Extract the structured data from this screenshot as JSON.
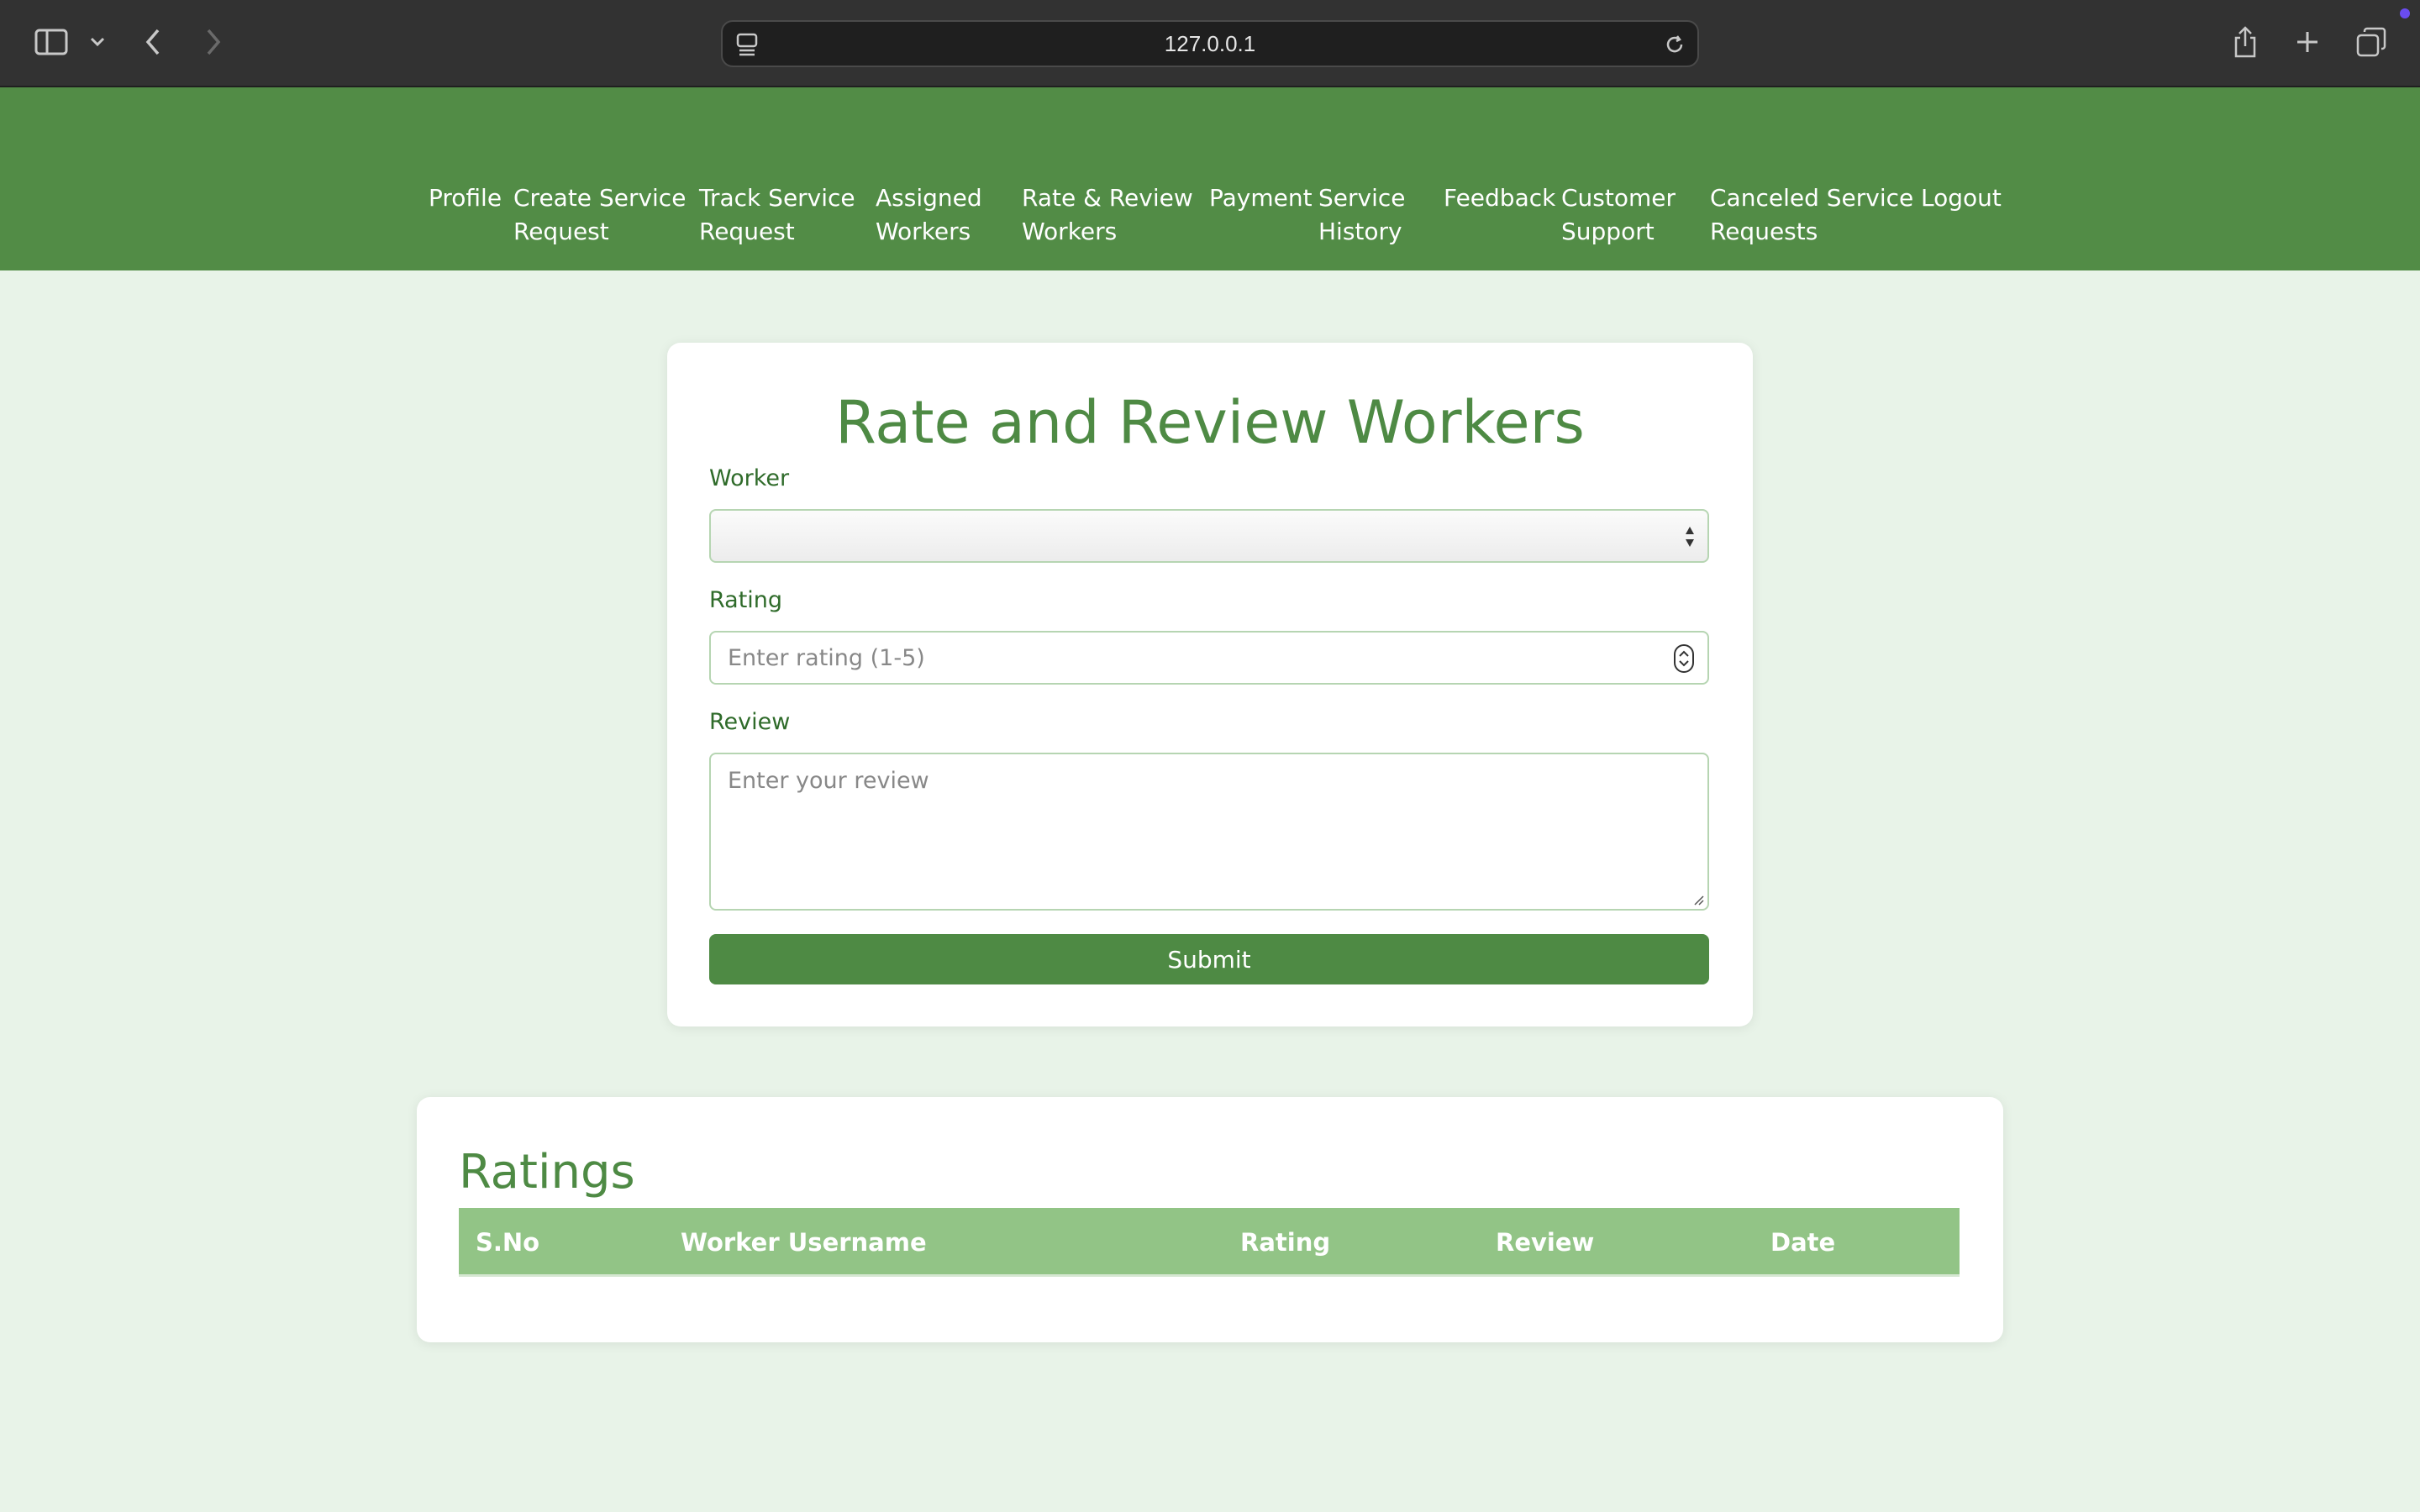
{
  "browser": {
    "url": "127.0.0.1"
  },
  "nav": {
    "items": [
      {
        "label_line1": "Profile",
        "label_line2": ""
      },
      {
        "label_line1": "Create Service",
        "label_line2": "Request"
      },
      {
        "label_line1": "Track Service",
        "label_line2": "Request"
      },
      {
        "label_line1": "Assigned",
        "label_line2": "Workers"
      },
      {
        "label_line1": "Rate & Review",
        "label_line2": "Workers"
      },
      {
        "label_line1": "Payment",
        "label_line2": ""
      },
      {
        "label_line1": "Service",
        "label_line2": "History"
      },
      {
        "label_line1": "Feedback",
        "label_line2": ""
      },
      {
        "label_line1": "Customer",
        "label_line2": "Support"
      },
      {
        "label_line1": "Canceled Service",
        "label_line2": "Requests"
      },
      {
        "label_line1": "Logout",
        "label_line2": ""
      }
    ]
  },
  "form": {
    "title": "Rate and Review Workers",
    "worker_label": "Worker",
    "worker_value": "",
    "rating_label": "Rating",
    "rating_placeholder": "Enter rating (1-5)",
    "review_label": "Review",
    "review_placeholder": "Enter your review",
    "submit_label": "Submit"
  },
  "ratings": {
    "title": "Ratings",
    "columns": [
      "S.No",
      "Worker Username",
      "Rating",
      "Review",
      "Date"
    ],
    "rows": []
  },
  "colors": {
    "nav_green": "#528c46",
    "accent_green": "#4e8a44",
    "table_header": "#92c486",
    "page_bg": "#e8f3e8"
  }
}
